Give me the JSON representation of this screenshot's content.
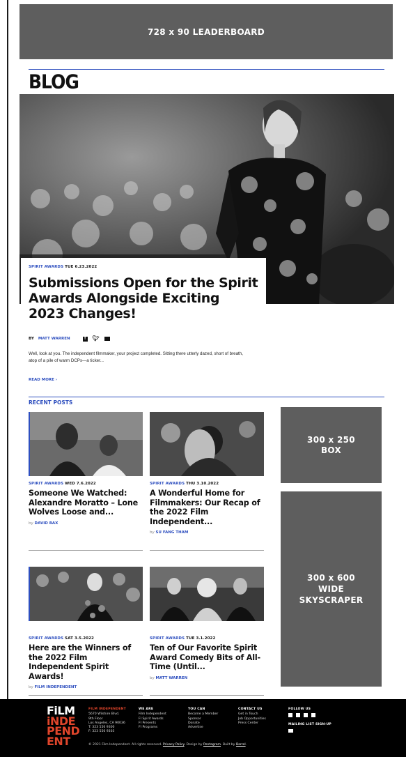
{
  "ads": {
    "leaderboard": "728 x 90 LEADERBOARD",
    "box_line1": "300 x 250",
    "box_line2": "BOX",
    "sky_line1": "300 x 600",
    "sky_line2": "WIDE",
    "sky_line3": "SKYSCRAPER"
  },
  "page": {
    "title": "BLOG"
  },
  "feature": {
    "category": "SPIRIT AWARDS",
    "date": "TUE 6.23.2022",
    "headline": "Submissions Open for the Spirit Awards Alongside Exciting 2023 Changes!",
    "by": "BY",
    "author": "MATT WARREN",
    "excerpt": "Well, look at you. The independent filmmaker, your project completed. Sitting there utterly dazed, short of breath, atop of a pile of warm DCPs—a ticker...",
    "read_more": "READ MORE ›",
    "share_icons": [
      "facebook-icon",
      "twitter-icon",
      "mail-icon"
    ]
  },
  "recent": {
    "title": "RECENT POSTS",
    "by": "by",
    "posts": [
      {
        "category": "SPIRIT AWARDS",
        "date": "WED 7.6.2022",
        "headline": "Someone We Watched: Alexandre Moratto – Lone Wolves Loose and...",
        "author": "DAVID BAX"
      },
      {
        "category": "SPIRIT AWARDS",
        "date": "THU 3.10.2022",
        "headline": "A Wonderful Home for Filmmakers: Our Recap of the 2022 Film Independent...",
        "author": "SU FANG THAM"
      },
      {
        "category": "SPIRIT AWARDS",
        "date": "SAT 3.5.2022",
        "headline": "Here are the Winners of the 2022 Film Independent Spirit Awards!",
        "author": "FILM INDEPENDENT"
      },
      {
        "category": "SPIRIT AWARDS",
        "date": "TUE 3.1.2022",
        "headline": "Ten of Our Favorite Spirit Award Comedy Bits of All-Time (Until...",
        "author": "MATT WARREN"
      }
    ]
  },
  "footer": {
    "logo_line1": "FiLM",
    "logo_line2": "iNDE",
    "logo_line3": "PEND",
    "logo_line4": "ENT",
    "org": {
      "heading": "FILM INDEPENDENT",
      "lines": [
        "5670 Wilshire Blvd.",
        "9th Floor",
        "Los Angeles, CA 90036",
        "T: 323 556 9300",
        "F: 323 556 9303"
      ]
    },
    "we_are": {
      "heading": "WE ARE",
      "links": [
        "Film Independent",
        "FI Spirit Awards",
        "FI Presents",
        "FI Programs"
      ]
    },
    "you_can": {
      "heading": "YOU CAN",
      "links": [
        "Become a Member",
        "Sponsor",
        "Donate",
        "Advertise"
      ]
    },
    "contact": {
      "heading": "CONTACT US",
      "links": [
        "Get in Touch",
        "Job Opportunities",
        "Press Center"
      ]
    },
    "follow": {
      "heading": "FOLLOW US",
      "icons": [
        "facebook-icon",
        "twitter-icon",
        "instagram-icon",
        "youtube-icon"
      ]
    },
    "mailing": {
      "heading": "MAILING LIST SIGN-UP"
    },
    "copyright": "© 2021 Film Independent. All rights reserved.",
    "privacy": "Privacy Policy",
    "design_by": "Design by",
    "designer": "Pentagram",
    "built_by": "Built by",
    "builder": "Barrel"
  },
  "colors": {
    "accent": "#2e4fbf",
    "ad_gray": "#5e5e5e",
    "logo_red": "#e0452b",
    "footer_bg": "#000000"
  }
}
